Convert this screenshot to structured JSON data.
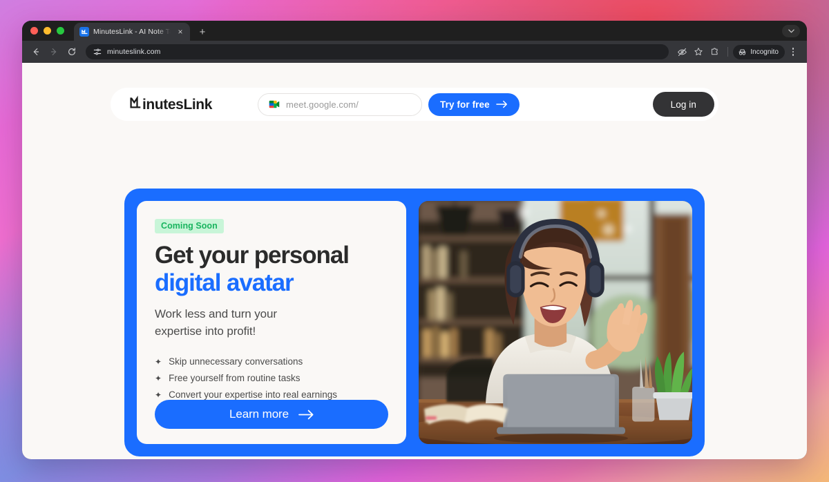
{
  "browser": {
    "tab": {
      "title": "MinutesLink - AI Note Taker f",
      "favicon_name": "minuteslink-favicon",
      "close_label": "×"
    },
    "new_tab_label": "+",
    "toolbar": {
      "back_label": "←",
      "forward_label": "→",
      "reload_label": "⟳",
      "url": "minuteslink.com",
      "site_settings_icon": "tune-icon",
      "hide_icon": "eye-slash-icon",
      "bookmark_icon": "star-icon",
      "extensions_icon": "puzzle-icon",
      "incognito_label": "Incognito",
      "menu_icon": "kebab-menu-icon"
    }
  },
  "site": {
    "nav": {
      "brand": "inutesLink",
      "meet_input_placeholder": "meet.google.com/",
      "meet_input_value": "",
      "meet_icon": "google-meet-icon",
      "try_label": "Try for free",
      "try_arrow": "→",
      "login_label": "Log in"
    },
    "hero": {
      "badge": "Coming Soon",
      "title_line1": "Get your personal",
      "title_line2": "digital avatar",
      "subtitle_line1": "Work less and turn your",
      "subtitle_line2": "expertise into profit!",
      "bullet_marker": "✦",
      "bullets": [
        "Skip unnecessary conversations",
        "Free yourself from routine tasks",
        "Convert your expertise into real earnings"
      ],
      "cta_label": "Learn more",
      "cta_arrow": "→",
      "photo_alt": "Woman wearing headphones waving at a laptop during a video call in a cafe"
    }
  },
  "colors": {
    "brand_blue": "#1a6dff",
    "badge_bg": "#c8f5d8",
    "badge_text": "#18b45e",
    "page_bg": "#faf8f6",
    "login_bg": "#333335"
  }
}
